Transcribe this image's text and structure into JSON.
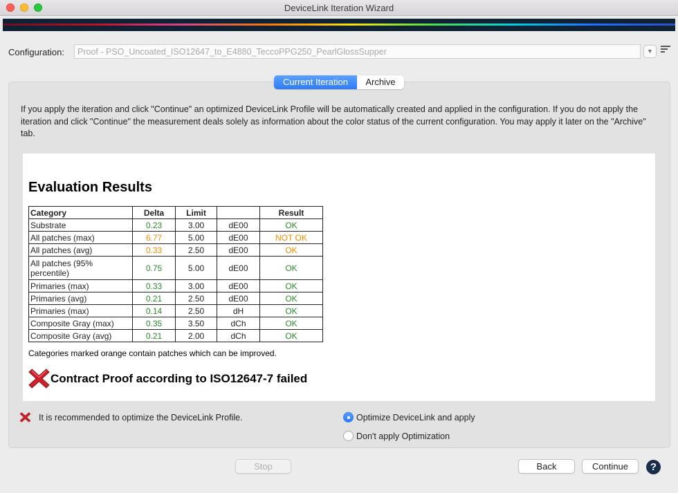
{
  "window": {
    "title": "DeviceLink Iteration Wizard"
  },
  "configuration": {
    "label": "Configuration:",
    "value": "Proof - PSO_Uncoated_ISO12647_to_E4880_TeccoPPG250_PearlGlossSupper"
  },
  "tabs": [
    {
      "label": "Current Iteration",
      "active": true
    },
    {
      "label": "Archive",
      "active": false
    }
  ],
  "info_text": "If you apply the iteration and click \"Continue\" an optimized DeviceLink Profile will be automatically created and applied in the configuration. If you do not apply the iteration and click \"Continue\" the measurement deals solely as information about the color status of the current configuration. You may apply it later on the \"Archive\" tab.",
  "report": {
    "title": "Evaluation Results",
    "headers": [
      "Category",
      "Delta",
      "Limit",
      "",
      "Result"
    ],
    "rows": [
      {
        "category": "Substrate",
        "delta": "0.23",
        "limit": "3.00",
        "unit": "dE00",
        "result": "OK",
        "status": "green"
      },
      {
        "category": "All patches (max)",
        "delta": "6.77",
        "limit": "5.00",
        "unit": "dE00",
        "result": "NOT OK",
        "status": "orange"
      },
      {
        "category": "All patches (avg)",
        "delta": "0.33",
        "limit": "2.50",
        "unit": "dE00",
        "result": "OK",
        "status": "orange"
      },
      {
        "category": "All patches (95% percentile)",
        "delta": "0.75",
        "limit": "5.00",
        "unit": "dE00",
        "result": "OK",
        "status": "green"
      },
      {
        "category": "Primaries (max)",
        "delta": "0.33",
        "limit": "3.00",
        "unit": "dE00",
        "result": "OK",
        "status": "green"
      },
      {
        "category": "Primaries (avg)",
        "delta": "0.21",
        "limit": "2.50",
        "unit": "dE00",
        "result": "OK",
        "status": "green"
      },
      {
        "category": "Primaries (max)",
        "delta": "0.14",
        "limit": "2.50",
        "unit": "dH",
        "result": "OK",
        "status": "green"
      },
      {
        "category": "Composite Gray (max)",
        "delta": "0.35",
        "limit": "3.50",
        "unit": "dCh",
        "result": "OK",
        "status": "green"
      },
      {
        "category": "Composite Gray (avg)",
        "delta": "0.21",
        "limit": "2.00",
        "unit": "dCh",
        "result": "OK",
        "status": "green"
      }
    ],
    "note": "Categories marked orange contain patches which can be improved.",
    "verdict": "Contract Proof according to ISO12647-7 failed"
  },
  "recommendation": "It is recommended to optimize the DeviceLink Profile.",
  "options": [
    {
      "label": "Optimize DeviceLink and apply",
      "selected": true
    },
    {
      "label": "Don't apply Optimization",
      "selected": false
    }
  ],
  "buttons": {
    "stop": "Stop",
    "back": "Back",
    "continue": "Continue",
    "help": "?"
  },
  "colors": {
    "ok": "#2b8a2b",
    "warn": "#f28c00",
    "accent": "#2f7cf6",
    "fail": "#d0202a"
  }
}
